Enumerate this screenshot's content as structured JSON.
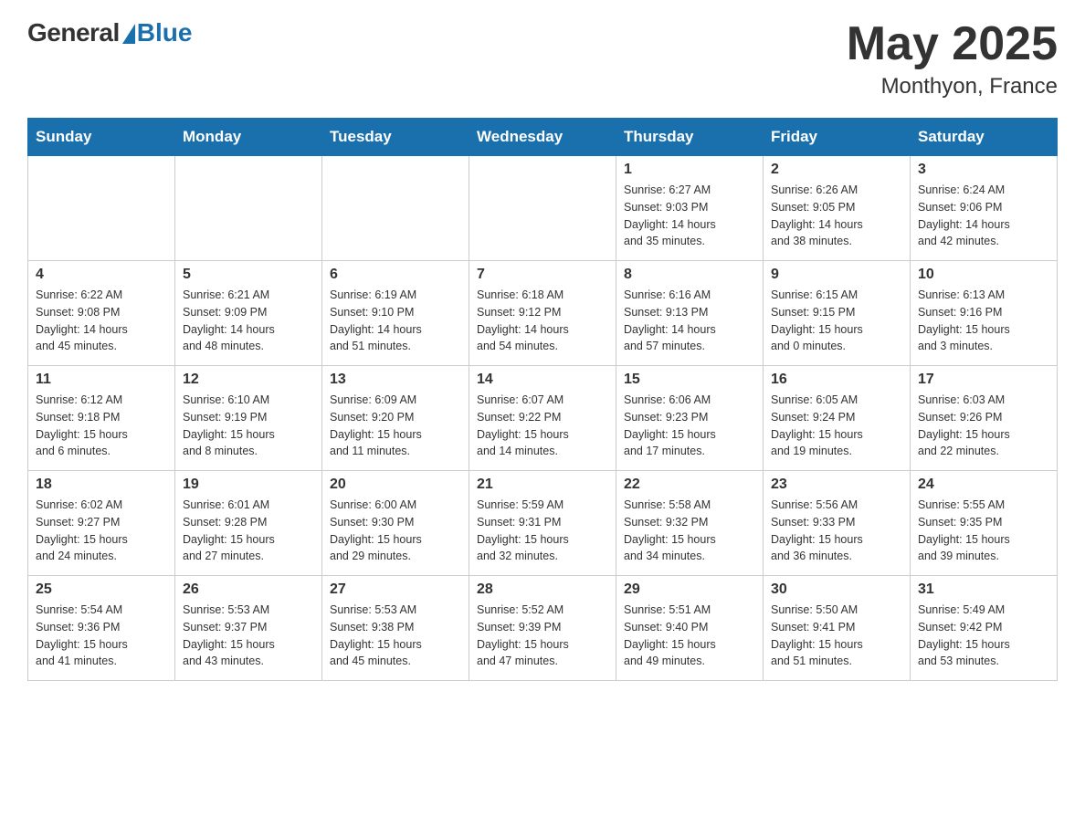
{
  "header": {
    "logo": {
      "general_text": "General",
      "blue_text": "Blue"
    },
    "title": "May 2025",
    "location": "Monthyon, France"
  },
  "days_of_week": [
    "Sunday",
    "Monday",
    "Tuesday",
    "Wednesday",
    "Thursday",
    "Friday",
    "Saturday"
  ],
  "weeks": [
    [
      {
        "day": "",
        "info": ""
      },
      {
        "day": "",
        "info": ""
      },
      {
        "day": "",
        "info": ""
      },
      {
        "day": "",
        "info": ""
      },
      {
        "day": "1",
        "info": "Sunrise: 6:27 AM\nSunset: 9:03 PM\nDaylight: 14 hours\nand 35 minutes."
      },
      {
        "day": "2",
        "info": "Sunrise: 6:26 AM\nSunset: 9:05 PM\nDaylight: 14 hours\nand 38 minutes."
      },
      {
        "day": "3",
        "info": "Sunrise: 6:24 AM\nSunset: 9:06 PM\nDaylight: 14 hours\nand 42 minutes."
      }
    ],
    [
      {
        "day": "4",
        "info": "Sunrise: 6:22 AM\nSunset: 9:08 PM\nDaylight: 14 hours\nand 45 minutes."
      },
      {
        "day": "5",
        "info": "Sunrise: 6:21 AM\nSunset: 9:09 PM\nDaylight: 14 hours\nand 48 minutes."
      },
      {
        "day": "6",
        "info": "Sunrise: 6:19 AM\nSunset: 9:10 PM\nDaylight: 14 hours\nand 51 minutes."
      },
      {
        "day": "7",
        "info": "Sunrise: 6:18 AM\nSunset: 9:12 PM\nDaylight: 14 hours\nand 54 minutes."
      },
      {
        "day": "8",
        "info": "Sunrise: 6:16 AM\nSunset: 9:13 PM\nDaylight: 14 hours\nand 57 minutes."
      },
      {
        "day": "9",
        "info": "Sunrise: 6:15 AM\nSunset: 9:15 PM\nDaylight: 15 hours\nand 0 minutes."
      },
      {
        "day": "10",
        "info": "Sunrise: 6:13 AM\nSunset: 9:16 PM\nDaylight: 15 hours\nand 3 minutes."
      }
    ],
    [
      {
        "day": "11",
        "info": "Sunrise: 6:12 AM\nSunset: 9:18 PM\nDaylight: 15 hours\nand 6 minutes."
      },
      {
        "day": "12",
        "info": "Sunrise: 6:10 AM\nSunset: 9:19 PM\nDaylight: 15 hours\nand 8 minutes."
      },
      {
        "day": "13",
        "info": "Sunrise: 6:09 AM\nSunset: 9:20 PM\nDaylight: 15 hours\nand 11 minutes."
      },
      {
        "day": "14",
        "info": "Sunrise: 6:07 AM\nSunset: 9:22 PM\nDaylight: 15 hours\nand 14 minutes."
      },
      {
        "day": "15",
        "info": "Sunrise: 6:06 AM\nSunset: 9:23 PM\nDaylight: 15 hours\nand 17 minutes."
      },
      {
        "day": "16",
        "info": "Sunrise: 6:05 AM\nSunset: 9:24 PM\nDaylight: 15 hours\nand 19 minutes."
      },
      {
        "day": "17",
        "info": "Sunrise: 6:03 AM\nSunset: 9:26 PM\nDaylight: 15 hours\nand 22 minutes."
      }
    ],
    [
      {
        "day": "18",
        "info": "Sunrise: 6:02 AM\nSunset: 9:27 PM\nDaylight: 15 hours\nand 24 minutes."
      },
      {
        "day": "19",
        "info": "Sunrise: 6:01 AM\nSunset: 9:28 PM\nDaylight: 15 hours\nand 27 minutes."
      },
      {
        "day": "20",
        "info": "Sunrise: 6:00 AM\nSunset: 9:30 PM\nDaylight: 15 hours\nand 29 minutes."
      },
      {
        "day": "21",
        "info": "Sunrise: 5:59 AM\nSunset: 9:31 PM\nDaylight: 15 hours\nand 32 minutes."
      },
      {
        "day": "22",
        "info": "Sunrise: 5:58 AM\nSunset: 9:32 PM\nDaylight: 15 hours\nand 34 minutes."
      },
      {
        "day": "23",
        "info": "Sunrise: 5:56 AM\nSunset: 9:33 PM\nDaylight: 15 hours\nand 36 minutes."
      },
      {
        "day": "24",
        "info": "Sunrise: 5:55 AM\nSunset: 9:35 PM\nDaylight: 15 hours\nand 39 minutes."
      }
    ],
    [
      {
        "day": "25",
        "info": "Sunrise: 5:54 AM\nSunset: 9:36 PM\nDaylight: 15 hours\nand 41 minutes."
      },
      {
        "day": "26",
        "info": "Sunrise: 5:53 AM\nSunset: 9:37 PM\nDaylight: 15 hours\nand 43 minutes."
      },
      {
        "day": "27",
        "info": "Sunrise: 5:53 AM\nSunset: 9:38 PM\nDaylight: 15 hours\nand 45 minutes."
      },
      {
        "day": "28",
        "info": "Sunrise: 5:52 AM\nSunset: 9:39 PM\nDaylight: 15 hours\nand 47 minutes."
      },
      {
        "day": "29",
        "info": "Sunrise: 5:51 AM\nSunset: 9:40 PM\nDaylight: 15 hours\nand 49 minutes."
      },
      {
        "day": "30",
        "info": "Sunrise: 5:50 AM\nSunset: 9:41 PM\nDaylight: 15 hours\nand 51 minutes."
      },
      {
        "day": "31",
        "info": "Sunrise: 5:49 AM\nSunset: 9:42 PM\nDaylight: 15 hours\nand 53 minutes."
      }
    ]
  ]
}
